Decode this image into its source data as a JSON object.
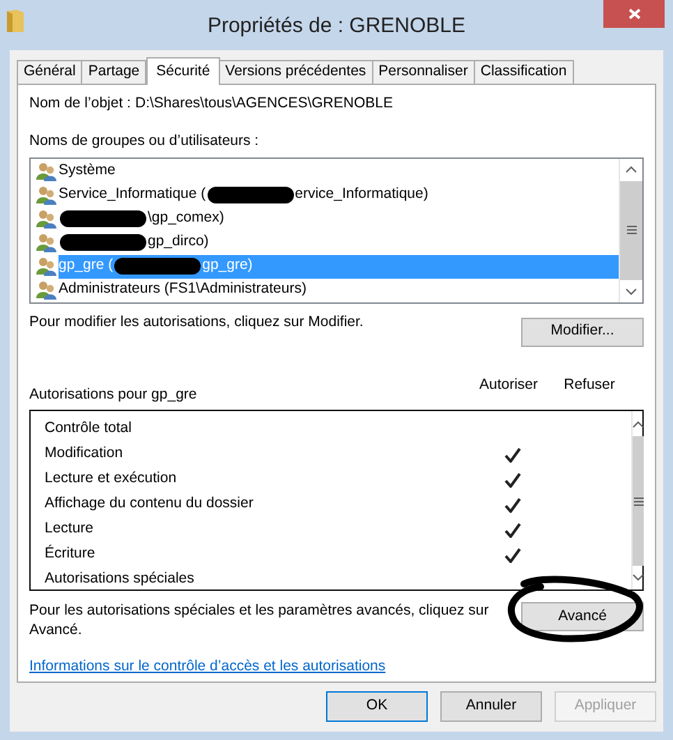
{
  "window": {
    "title": "Propriétés de : GRENOBLE"
  },
  "tabs": [
    {
      "label": "Général",
      "selected": false
    },
    {
      "label": "Partage",
      "selected": false
    },
    {
      "label": "Sécurité",
      "selected": true
    },
    {
      "label": "Versions précédentes",
      "selected": false
    },
    {
      "label": "Personnaliser",
      "selected": false
    },
    {
      "label": "Classification",
      "selected": false
    }
  ],
  "object_name": {
    "label": "Nom de l’objet :",
    "value": "D:\\Shares\\tous\\AGENCES\\GRENOBLE"
  },
  "groups": {
    "label": "Noms de groupes ou d’utilisateurs :",
    "items": [
      {
        "selected": false,
        "parts": [
          {
            "kind": "text",
            "text": "Système"
          }
        ]
      },
      {
        "selected": false,
        "parts": [
          {
            "kind": "text",
            "text": "Service_Informatique ("
          },
          {
            "kind": "redacted"
          },
          {
            "kind": "text",
            "text": "ervice_Informatique)"
          }
        ]
      },
      {
        "selected": false,
        "parts": [
          {
            "kind": "redacted"
          },
          {
            "kind": "text",
            "text": "\\gp_comex)"
          }
        ]
      },
      {
        "selected": false,
        "parts": [
          {
            "kind": "redacted"
          },
          {
            "kind": "text",
            "text": "gp_dirco)"
          }
        ]
      },
      {
        "selected": true,
        "parts": [
          {
            "kind": "text",
            "text": "gp_gre ("
          },
          {
            "kind": "redacted"
          },
          {
            "kind": "text",
            "text": "gp_gre)"
          }
        ]
      },
      {
        "selected": false,
        "parts": [
          {
            "kind": "text",
            "text": "Administrateurs (FS1\\Administrateurs)"
          }
        ]
      }
    ]
  },
  "modify_hint": "Pour modifier les autorisations, cliquez sur Modifier.",
  "modify_button": "Modifier...",
  "permissions": {
    "label": "Autorisations pour gp_gre",
    "columns": [
      "Autoriser",
      "Refuser"
    ],
    "rows": [
      {
        "name": "Contrôle total",
        "allow": false,
        "deny": false
      },
      {
        "name": "Modification",
        "allow": true,
        "deny": false
      },
      {
        "name": "Lecture et exécution",
        "allow": true,
        "deny": false
      },
      {
        "name": "Affichage du contenu du dossier",
        "allow": true,
        "deny": false
      },
      {
        "name": "Lecture",
        "allow": true,
        "deny": false
      },
      {
        "name": "Écriture",
        "allow": true,
        "deny": false
      },
      {
        "name": "Autorisations spéciales",
        "allow": false,
        "deny": false
      }
    ]
  },
  "advanced_hint": "Pour les autorisations spéciales et les paramètres avancés, cliquez sur Avancé.",
  "advanced_button": "Avancé",
  "link": "Informations sur le contrôle d’accès et les autorisations",
  "buttons": [
    {
      "label": "OK",
      "default": true,
      "disabled": false
    },
    {
      "label": "Annuler",
      "default": false,
      "disabled": false
    },
    {
      "label": "Appliquer",
      "default": false,
      "disabled": true
    }
  ]
}
